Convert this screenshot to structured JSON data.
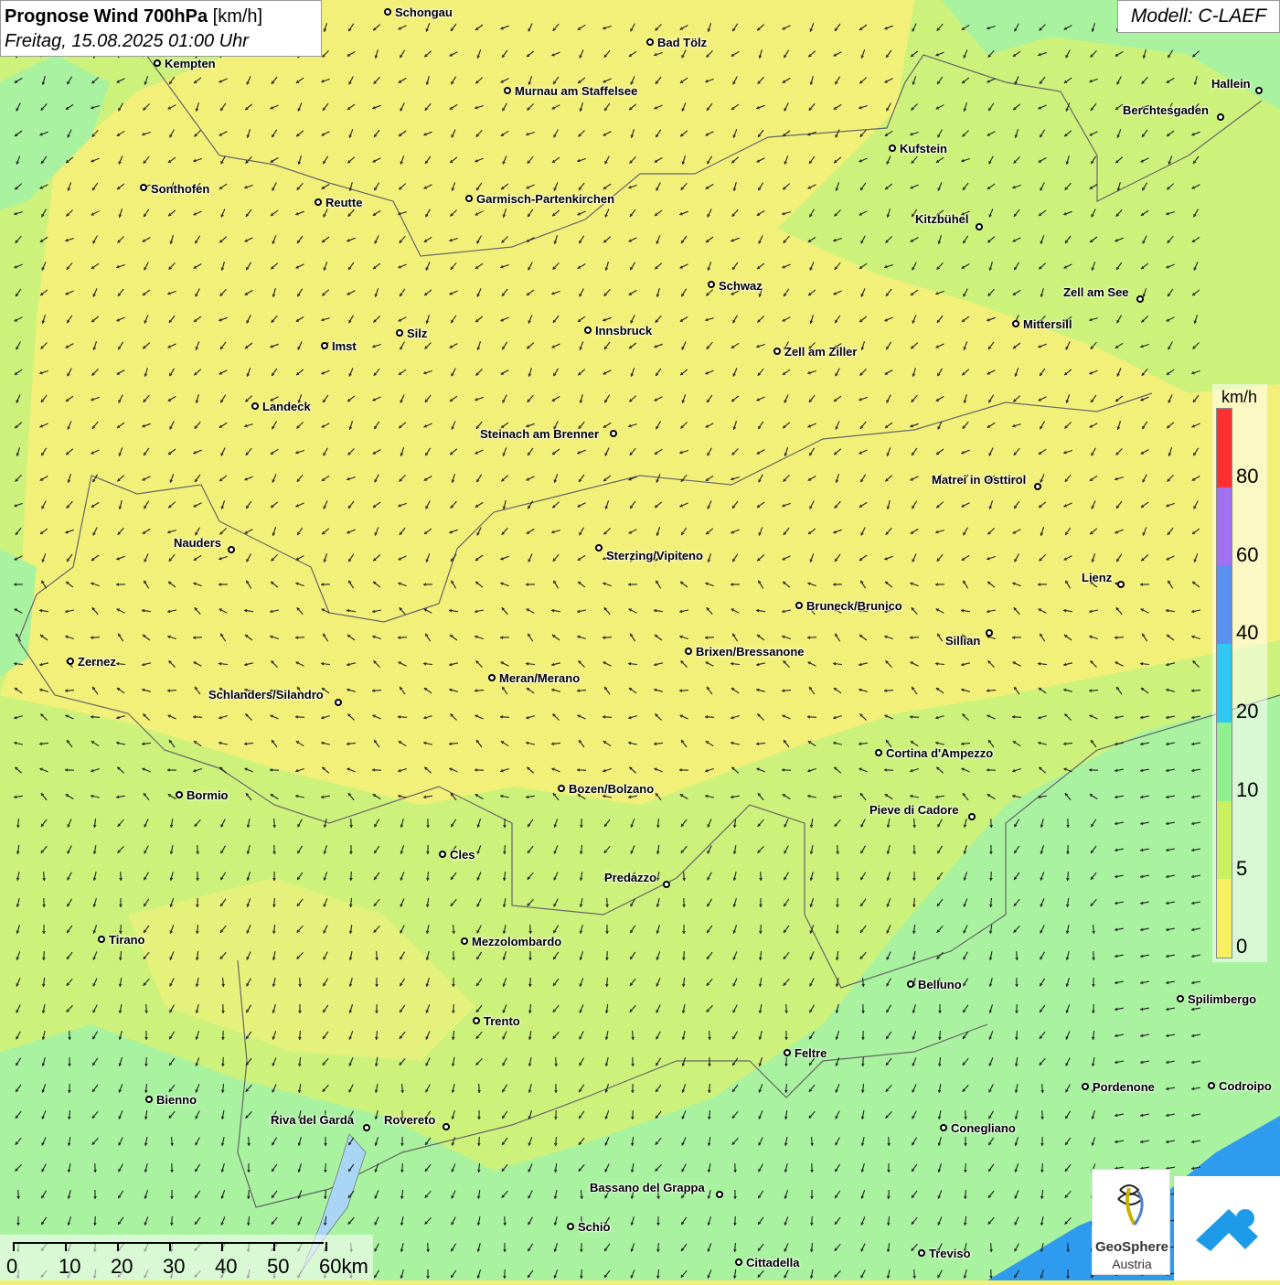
{
  "header": {
    "title_bold": "Prognose Wind 700hPa",
    "title_unit": "[km/h]",
    "subtitle": "Freitag, 15.08.2025 01:00 Uhr"
  },
  "model_label": "Modell: C-LAEF",
  "legend": {
    "unit": "km/h",
    "ticks": [
      "80",
      "60",
      "40",
      "20",
      "10",
      "5",
      "0"
    ],
    "colors": [
      "#ff3030",
      "#a070f0",
      "#5a90f0",
      "#30c8f0",
      "#90f090",
      "#c8f060",
      "#f8f060"
    ]
  },
  "colors": {
    "yellow": "#f3f07a",
    "lime": "#cdf27c",
    "green": "#a8f2a0",
    "sea": "#2f9bef"
  },
  "scalebar": {
    "labels": [
      "0",
      "10",
      "20",
      "30",
      "40",
      "50",
      "60km"
    ]
  },
  "cities": [
    {
      "name": "Schongau"
    },
    {
      "name": "Bad Tölz"
    },
    {
      "name": "Kempten"
    },
    {
      "name": "Murnau am Staffelsee"
    },
    {
      "name": "Hallein"
    },
    {
      "name": "Berchtesgaden"
    },
    {
      "name": "Kufstein"
    },
    {
      "name": "Sonthofen"
    },
    {
      "name": "Reutte"
    },
    {
      "name": "Garmisch-Partenkirchen"
    },
    {
      "name": "Kitzbühel"
    },
    {
      "name": "Schwaz"
    },
    {
      "name": "Zell am See"
    },
    {
      "name": "Mittersill"
    },
    {
      "name": "Innsbruck"
    },
    {
      "name": "Silz"
    },
    {
      "name": "Imst"
    },
    {
      "name": "Zell am Ziller"
    },
    {
      "name": "Landeck"
    },
    {
      "name": "Steinach am Brenner"
    },
    {
      "name": "Matrei in Osttirol"
    },
    {
      "name": "Nauders"
    },
    {
      "name": "Sterzing/Vipiteno"
    },
    {
      "name": "Lienz"
    },
    {
      "name": "Bruneck/Brunico"
    },
    {
      "name": "Sillian"
    },
    {
      "name": "Zernez"
    },
    {
      "name": "Brixen/Bressanone"
    },
    {
      "name": "Meran/Merano"
    },
    {
      "name": "Schlanders/Silandro"
    },
    {
      "name": "Cortina d'Ampezzo"
    },
    {
      "name": "Bormio"
    },
    {
      "name": "Bozen/Bolzano"
    },
    {
      "name": "Pieve di Cadore"
    },
    {
      "name": "Cles"
    },
    {
      "name": "Predazzo"
    },
    {
      "name": "Tirano"
    },
    {
      "name": "Mezzolombardo"
    },
    {
      "name": "Belluno"
    },
    {
      "name": "Spilimbergo"
    },
    {
      "name": "Trento"
    },
    {
      "name": "Feltre"
    },
    {
      "name": "Pordenone"
    },
    {
      "name": "Codroipo"
    },
    {
      "name": "Bienno"
    },
    {
      "name": "Riva del Garda"
    },
    {
      "name": "Rovereto"
    },
    {
      "name": "Conegliano"
    },
    {
      "name": "Bassano del Grappa"
    },
    {
      "name": "Schio"
    },
    {
      "name": "Treviso"
    },
    {
      "name": "Cittadella"
    }
  ],
  "logo": {
    "line1": "GeoSphere",
    "line2": "Austria"
  }
}
